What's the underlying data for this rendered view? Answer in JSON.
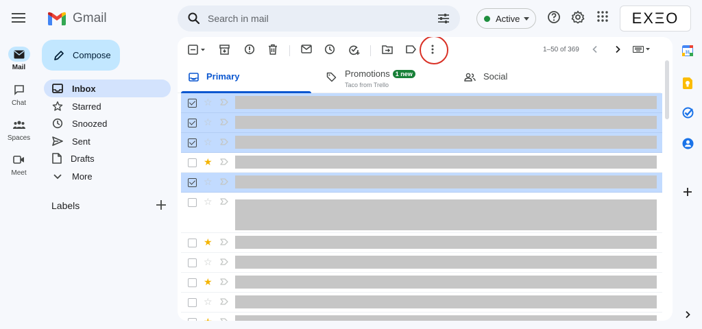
{
  "app": {
    "name": "Gmail"
  },
  "org": {
    "logo_text": "EXΞO"
  },
  "search": {
    "placeholder": "Search in mail"
  },
  "status": {
    "label": "Active",
    "color": "#1e8e3e"
  },
  "rail": [
    {
      "label": "Mail",
      "icon": "mail-icon"
    },
    {
      "label": "Chat",
      "icon": "chat-icon"
    },
    {
      "label": "Spaces",
      "icon": "spaces-icon"
    },
    {
      "label": "Meet",
      "icon": "meet-icon"
    }
  ],
  "compose": {
    "label": "Compose"
  },
  "nav": [
    {
      "label": "Inbox",
      "icon": "inbox-icon"
    },
    {
      "label": "Starred",
      "icon": "star-icon"
    },
    {
      "label": "Snoozed",
      "icon": "clock-icon"
    },
    {
      "label": "Sent",
      "icon": "send-icon"
    },
    {
      "label": "Drafts",
      "icon": "draft-icon"
    },
    {
      "label": "More",
      "icon": "chevron-down-icon"
    }
  ],
  "labels": {
    "header": "Labels"
  },
  "toolbar": {
    "pager": "1–50 of 369"
  },
  "tabs": [
    {
      "label": "Primary"
    },
    {
      "label": "Promotions",
      "badge": "1 new",
      "sub": "Taco from Trello"
    },
    {
      "label": "Social"
    }
  ],
  "rows": [
    {
      "selected": true,
      "starred": false
    },
    {
      "selected": true,
      "starred": false
    },
    {
      "selected": true,
      "starred": false
    },
    {
      "selected": false,
      "starred": true
    },
    {
      "selected": true,
      "starred": false
    },
    {
      "selected": false,
      "starred": false,
      "tall": true
    },
    {
      "selected": false,
      "starred": true
    },
    {
      "selected": false,
      "starred": false
    },
    {
      "selected": false,
      "starred": true
    },
    {
      "selected": false,
      "starred": false
    },
    {
      "selected": false,
      "starred": true
    }
  ],
  "colors": {
    "accent": "#0b57d0",
    "selected_row": "#c2dbff",
    "highlight_ring": "#d93025"
  }
}
